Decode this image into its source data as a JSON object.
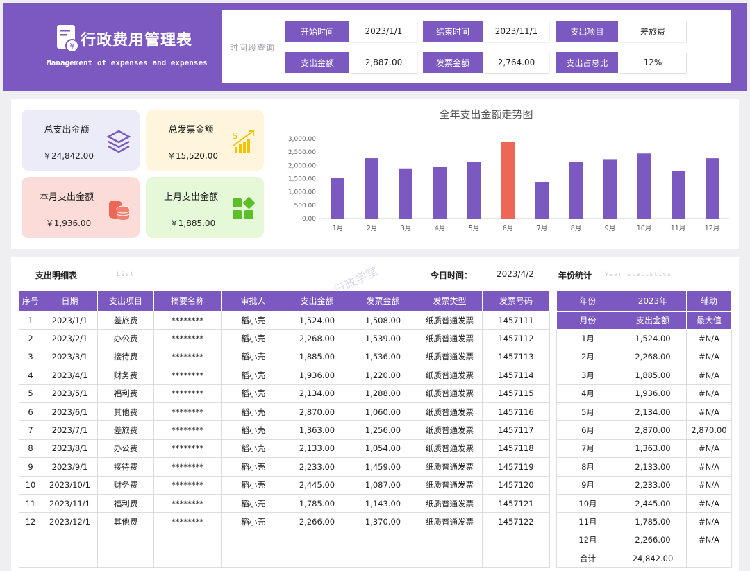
{
  "header": {
    "title": "行政费用管理表",
    "subtitle": "Management of expenses and expenses",
    "logo_icon": "receipt-yen-icon"
  },
  "query": {
    "label": "时间段查询",
    "start_label": "开始时间",
    "start_value": "2023/1/1",
    "end_label": "结束时间",
    "end_value": "2023/11/1",
    "item_label": "支出项目",
    "item_value": "差旅费",
    "amount_label": "支出金额",
    "amount_value": "2,887.00",
    "invoice_label": "发票金额",
    "invoice_value": "2,764.00",
    "ratio_label": "支出占总比",
    "ratio_value": "12%"
  },
  "cards": {
    "total_expense": {
      "label": "总支出金额",
      "value": "￥24,842.00",
      "icon": "layers-icon",
      "color": "#ecebf8"
    },
    "total_invoice": {
      "label": "总发票金额",
      "value": "￥15,520.00",
      "icon": "money-growth-icon",
      "color": "#fff5dc"
    },
    "month_expense": {
      "label": "本月支出金额",
      "value": "￥1,936.00",
      "icon": "coin-stack-icon",
      "color": "#fbdcd8"
    },
    "last_month_expense": {
      "label": "上月支出金额",
      "value": "￥1,885.00",
      "icon": "apps-grid-icon",
      "color": "#e5f8d8"
    }
  },
  "chart_data": {
    "type": "bar",
    "title": "全年支出金额走势图",
    "categories": [
      "1月",
      "2月",
      "3月",
      "4月",
      "5月",
      "6月",
      "7月",
      "8月",
      "9月",
      "10月",
      "11月",
      "12月"
    ],
    "values": [
      1524,
      2268,
      1885,
      1936,
      2134,
      2870,
      1363,
      2133,
      2233,
      2445,
      1785,
      2266
    ],
    "highlight_index": 5,
    "ylim": [
      0,
      3000
    ],
    "yticks": [
      "0.00",
      "500.00",
      "1,000.00",
      "1,500.00",
      "2,000.00",
      "2,500.00",
      "3,000.00"
    ],
    "bar_color": "#7b59c0",
    "highlight_color": "#ee6655",
    "grid": false
  },
  "detail": {
    "title": "支出明细表",
    "ghost": "List",
    "today_label": "今日时间：",
    "today_value": "2023/4/2",
    "year_stat_label": "年份统计",
    "year_stat_ghost": "Year statistics",
    "watermark": "个人-行政学堂",
    "columns": [
      "序号",
      "日期",
      "支出项目",
      "摘要名称",
      "审批人",
      "支出金额",
      "发票金额",
      "发票类型",
      "发票号码"
    ],
    "rows": [
      [
        "1",
        "2023/1/1",
        "差旅费",
        "********",
        "稻小壳",
        "1,524.00",
        "1,508.00",
        "纸质普通发票",
        "1457111"
      ],
      [
        "2",
        "2023/2/1",
        "办公费",
        "********",
        "稻小壳",
        "2,268.00",
        "1,539.00",
        "纸质普通发票",
        "1457112"
      ],
      [
        "3",
        "2023/3/1",
        "接待费",
        "********",
        "稻小壳",
        "1,885.00",
        "1,536.00",
        "纸质普通发票",
        "1457113"
      ],
      [
        "4",
        "2023/4/1",
        "财务费",
        "********",
        "稻小壳",
        "1,936.00",
        "1,220.00",
        "纸质普通发票",
        "1457114"
      ],
      [
        "5",
        "2023/5/1",
        "福利费",
        "********",
        "稻小壳",
        "2,134.00",
        "1,288.00",
        "纸质普通发票",
        "1457115"
      ],
      [
        "6",
        "2023/6/1",
        "其他费",
        "********",
        "稻小壳",
        "2,870.00",
        "1,060.00",
        "纸质普通发票",
        "1457116"
      ],
      [
        "7",
        "2023/7/1",
        "差旅费",
        "********",
        "稻小壳",
        "1,363.00",
        "1,256.00",
        "纸质普通发票",
        "1457117"
      ],
      [
        "8",
        "2023/8/1",
        "办公费",
        "********",
        "稻小壳",
        "2,133.00",
        "1,054.00",
        "纸质普通发票",
        "1457118"
      ],
      [
        "9",
        "2023/9/1",
        "接待费",
        "********",
        "稻小壳",
        "2,233.00",
        "1,459.00",
        "纸质普通发票",
        "1457119"
      ],
      [
        "10",
        "2023/10/1",
        "财务费",
        "********",
        "稻小壳",
        "2,445.00",
        "1,087.00",
        "纸质普通发票",
        "1457120"
      ],
      [
        "11",
        "2023/11/1",
        "福利费",
        "********",
        "稻小壳",
        "1,785.00",
        "1,143.00",
        "纸质普通发票",
        "1457121"
      ],
      [
        "12",
        "2023/12/1",
        "其他费",
        "********",
        "稻小壳",
        "2,266.00",
        "1,370.00",
        "纸质普通发票",
        "1457122"
      ],
      [
        "",
        "",
        "",
        "",
        "",
        "",
        "",
        "",
        ""
      ],
      [
        "",
        "",
        "",
        "",
        "",
        "",
        "",
        "",
        ""
      ]
    ]
  },
  "year_table": {
    "header1": [
      "年份",
      "2023年",
      "辅助"
    ],
    "header2": [
      "月份",
      "支出金额",
      "最大值"
    ],
    "rows": [
      [
        "1月",
        "1,524.00",
        "#N/A"
      ],
      [
        "2月",
        "2,268.00",
        "#N/A"
      ],
      [
        "3月",
        "1,885.00",
        "#N/A"
      ],
      [
        "4月",
        "1,936.00",
        "#N/A"
      ],
      [
        "5月",
        "2,134.00",
        "#N/A"
      ],
      [
        "6月",
        "2,870.00",
        "2,870.00"
      ],
      [
        "7月",
        "1,363.00",
        "#N/A"
      ],
      [
        "8月",
        "2,133.00",
        "#N/A"
      ],
      [
        "9月",
        "2,233.00",
        "#N/A"
      ],
      [
        "10月",
        "2,445.00",
        "#N/A"
      ],
      [
        "11月",
        "1,785.00",
        "#N/A"
      ],
      [
        "12月",
        "2,266.00",
        "#N/A"
      ],
      [
        "合计",
        "24,842.00",
        ""
      ]
    ]
  }
}
